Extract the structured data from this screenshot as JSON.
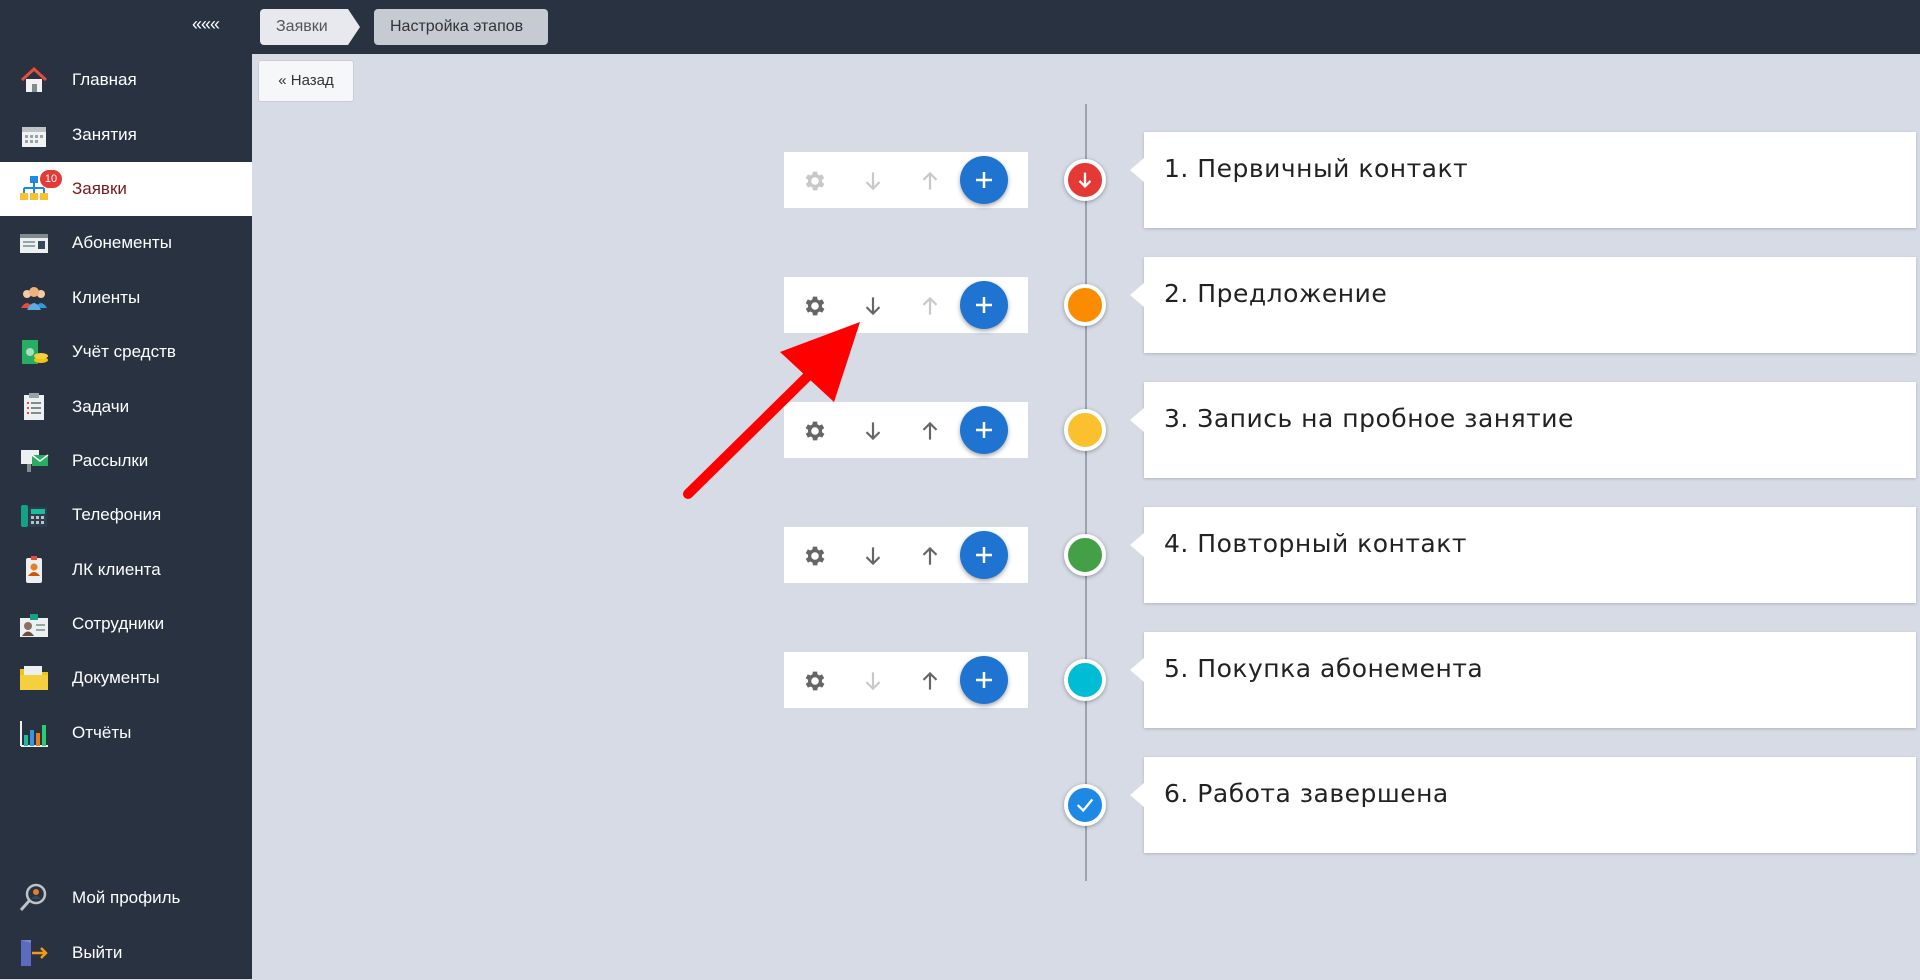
{
  "sidebar": {
    "collapse_label": "«««",
    "items": [
      {
        "label": "Главная",
        "icon": "home-icon"
      },
      {
        "label": "Занятия",
        "icon": "calendar-icon"
      },
      {
        "label": "Заявки",
        "icon": "org-chart-icon",
        "badge": "10",
        "active": true
      },
      {
        "label": "Абонементы",
        "icon": "membership-card-icon"
      },
      {
        "label": "Клиенты",
        "icon": "clients-icon"
      },
      {
        "label": "Учёт средств",
        "icon": "money-icon"
      },
      {
        "label": "Задачи",
        "icon": "task-list-icon"
      },
      {
        "label": "Рассылки",
        "icon": "mailing-icon"
      },
      {
        "label": "Телефония",
        "icon": "phone-icon"
      },
      {
        "label": "ЛК клиента",
        "icon": "client-account-icon"
      },
      {
        "label": "Сотрудники",
        "icon": "staff-icon"
      },
      {
        "label": "Документы",
        "icon": "documents-icon"
      },
      {
        "label": "Отчёты",
        "icon": "reports-icon"
      }
    ],
    "bottom_items": [
      {
        "label": "Мой профиль",
        "icon": "profile-icon"
      },
      {
        "label": "Выйти",
        "icon": "logout-icon"
      }
    ]
  },
  "breadcrumb": {
    "items": [
      "Заявки",
      "Настройка этапов"
    ]
  },
  "back_button": "« Назад",
  "stages": [
    {
      "title": "1. Первичный контакт",
      "color": "#e53935",
      "marker": "down-arrow",
      "down_enabled": false,
      "up_enabled": false
    },
    {
      "title": "2. Предложение",
      "color": "#fb8c00",
      "marker": "none",
      "down_enabled": true,
      "up_enabled": false
    },
    {
      "title": "3. Запись на пробное занятие",
      "color": "#fbc02d",
      "marker": "none",
      "down_enabled": true,
      "up_enabled": true
    },
    {
      "title": "4. Повторный контакт",
      "color": "#43a047",
      "marker": "none",
      "down_enabled": true,
      "up_enabled": true
    },
    {
      "title": "5. Покупка абонемента",
      "color": "#00bcd4",
      "marker": "none",
      "down_enabled": false,
      "up_enabled": true
    },
    {
      "title": "6. Работа завершена",
      "color": "#1e88e5",
      "marker": "check"
    }
  ],
  "colors": {
    "sidebar_bg": "#283241",
    "content_bg": "#d6dbe6",
    "active_text": "#7a1a1a",
    "plus_button": "#1f74d1",
    "annotation_arrow": "#ff0000"
  }
}
